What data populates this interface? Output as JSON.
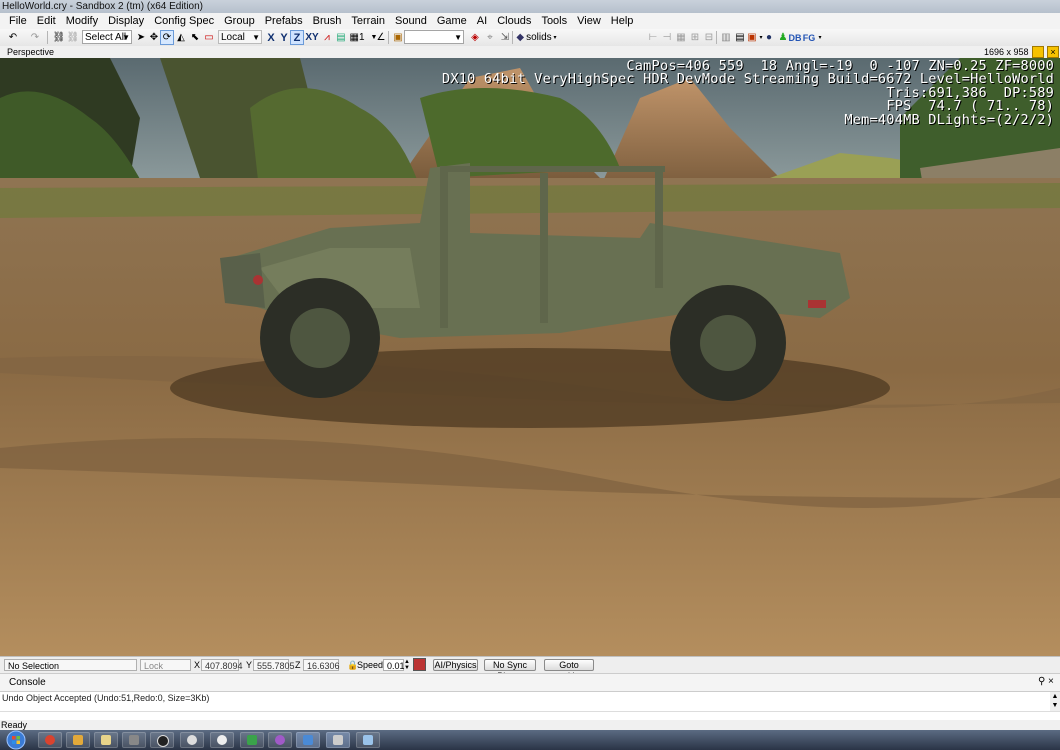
{
  "window": {
    "title": "HelloWorld.cry - Sandbox 2 (tm) (x64 Edition)"
  },
  "menu": [
    "File",
    "Edit",
    "Modify",
    "Display",
    "Config Spec",
    "Group",
    "Prefabs",
    "Brush",
    "Terrain",
    "Sound",
    "Game",
    "AI",
    "Clouds",
    "Tools",
    "View",
    "Help"
  ],
  "toolbar": {
    "select_all": "Select All",
    "coord_system": "Local",
    "axis_x": "X",
    "axis_y": "Y",
    "axis_z": "Z",
    "axis_xy": "XY",
    "grid_value": "1",
    "solids": "solids",
    "db_label": "DB",
    "fg_label": "FG",
    "active_axis": "Z"
  },
  "viewport": {
    "label": "Perspective",
    "resolution": "1696 x 958",
    "stats": [
      "CamPos=406 559  18 Angl=-19  0 -107 ZN=0.25 ZF=8000",
      "DX10 64bit VeryHighSpec HDR DevMode Streaming Build=6672 Level=HelloWorld",
      "Tris:691,386  DP:589",
      "FPS  74.7 ( 71.. 78)",
      "Mem=404MB DLights=(2/2/2)"
    ]
  },
  "status": {
    "selection": "No Selection",
    "lock_selection": "Lock Selection",
    "x_label": "X",
    "x_value": "407.8094",
    "y_label": "Y",
    "y_value": "555.7805",
    "z_label": "Z",
    "z_value": "16.6306",
    "speed_label": "Speed:",
    "speed_value": "0.01",
    "ai_physics": "AI/Physics",
    "no_sync_player": "No Sync Player",
    "goto_position": "Goto position"
  },
  "console": {
    "title": "Console",
    "pin": "%A",
    "close": "×",
    "log": "Undo Object Accepted (Undo:51,Redo:0, Size=3Kb)"
  },
  "app_status": "Ready",
  "colors": {
    "accent": "#f6c200",
    "taskbar": "#2a3446",
    "stats_text": "#ffffff"
  }
}
